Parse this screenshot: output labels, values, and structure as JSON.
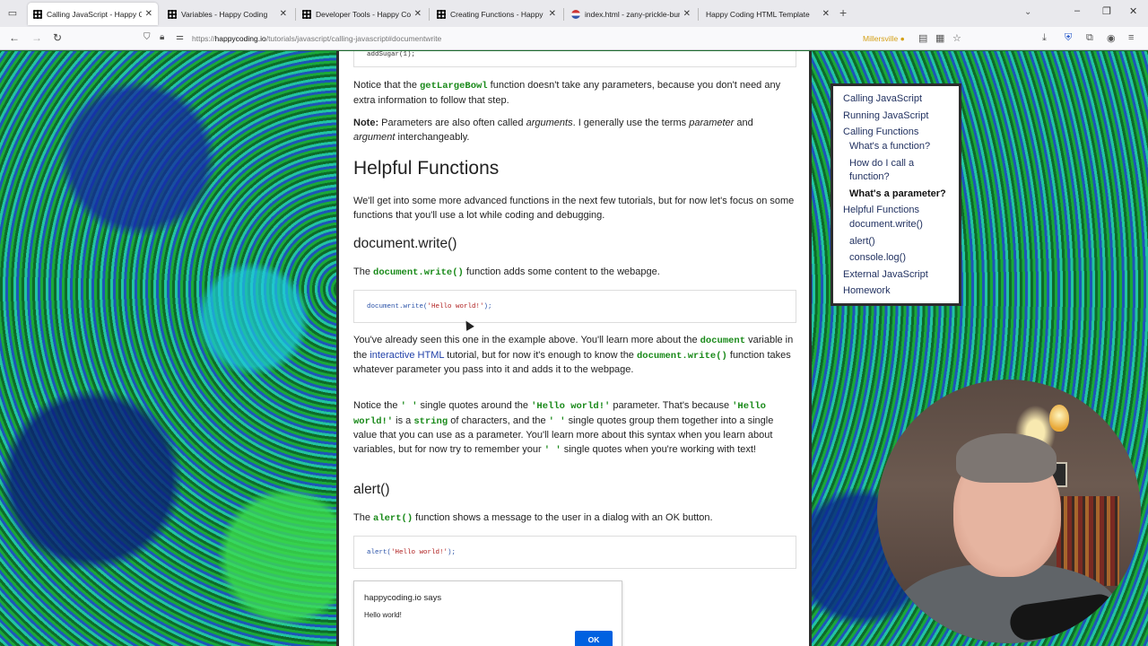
{
  "browser": {
    "tabs": [
      {
        "label": "Calling JavaScript - Happy Codi",
        "favicon": "grid",
        "active": true
      },
      {
        "label": "Variables - Happy Coding",
        "favicon": "grid",
        "active": false
      },
      {
        "label": "Developer Tools - Happy Codin",
        "favicon": "grid",
        "active": false
      },
      {
        "label": "Creating Functions - Happy Co",
        "favicon": "grid",
        "active": false
      },
      {
        "label": "index.html - zany-prickle-bum",
        "favicon": "flag",
        "active": false
      },
      {
        "label": "Happy Coding HTML Template",
        "favicon": "none",
        "active": false
      }
    ],
    "new_tab_glyph": "+",
    "window_controls": {
      "minimize": "–",
      "restore": "❐",
      "close": "✕"
    },
    "url": {
      "prefix": "https://",
      "host": "happycoding.io",
      "path": "/tutorials/javascript/calling-javascript#documentwrite"
    },
    "weather": "Millersville"
  },
  "article": {
    "top_code_fragment": "addSugar(1);",
    "p1": {
      "before": "Notice that the ",
      "code": "getLargeBowl",
      "after": " function doesn't take any parameters, because you don't need any extra information to follow that step."
    },
    "note": {
      "label": "Note:",
      "t1": " Parameters are also often called ",
      "e1": "arguments",
      "t2": ". I generally use the terms ",
      "e2": "parameter",
      "t3": " and ",
      "e3": "argument",
      "t4": " interchangeably."
    },
    "h2_helpful": "Helpful Functions",
    "p_helpful": "We'll get into some more advanced functions in the next few tutorials, but for now let's focus on some functions that you'll use a lot while coding and debugging.",
    "h3_docwrite": "document.write()",
    "p_dw": {
      "before": "The ",
      "code": "document.write()",
      "after": " function adds some content to the webapge."
    },
    "code_dw": {
      "fn": "document.write(",
      "str": "'Hello world!'",
      "end": ");"
    },
    "p_seen": {
      "t1": "You've already seen this one in the example above. You'll learn more about the ",
      "c1": "document",
      "t2": " variable in the ",
      "link": "interactive HTML",
      "t3": " tutorial, but for now it's enough to know the ",
      "c2": "document.write()",
      "t4": " function takes whatever parameter you pass into it and adds it to the webpage."
    },
    "p_quotes": {
      "t1": "Notice the ",
      "c1": "' '",
      "t2": " single quotes around the ",
      "c2": "'Hello world!'",
      "t3": " parameter. That's because ",
      "c3": "'Hello world!'",
      "t4": " is a ",
      "c4": "string",
      "t5": " of characters, and the ",
      "c5": "' '",
      "t6": " single quotes group them together into a single value that you can use as a parameter. You'll learn more about this syntax when you learn about variables, but for now try to remember your ",
      "c6": "' '",
      "t7": " single quotes when you're working with text!"
    },
    "h3_alert": "alert()",
    "p_alert": {
      "before": "The ",
      "code": "alert()",
      "after": " function shows a message to the user in a dialog with an OK button."
    },
    "code_alert": {
      "fn": "alert(",
      "str": "'Hello world!'",
      "end": ");"
    },
    "dialog": {
      "title": "happycoding.io says",
      "message": "Hello world!",
      "ok": "OK"
    }
  },
  "toc": {
    "items": [
      {
        "label": "Calling JavaScript",
        "level": 0
      },
      {
        "label": "Running JavaScript",
        "level": 0
      },
      {
        "label": "Calling Functions",
        "level": 0
      },
      {
        "label": "What's a function?",
        "level": 1
      },
      {
        "label": "How do I call a",
        "level": 1
      },
      {
        "label": "function?",
        "level": 1
      },
      {
        "label": "What's a parameter?",
        "level": 1,
        "active": true
      },
      {
        "label": "Helpful Functions",
        "level": 0
      },
      {
        "label": "document.write()",
        "level": 1
      },
      {
        "label": "alert()",
        "level": 1
      },
      {
        "label": "console.log()",
        "level": 1
      },
      {
        "label": "External JavaScript",
        "level": 0
      },
      {
        "label": "Homework",
        "level": 0
      }
    ]
  },
  "colors": {
    "code_green": "#1a8a1a",
    "link_blue": "#1f3fa8",
    "ok_button": "#0061e0",
    "frame_dark": "#2d2d2d"
  }
}
